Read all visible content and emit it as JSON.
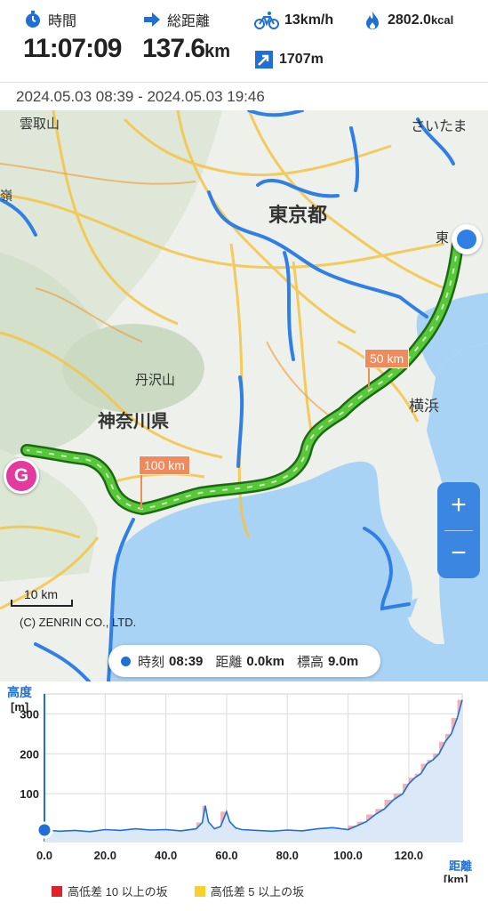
{
  "stats": {
    "time_label": "時間",
    "time_value": "11:07:09",
    "distance_label": "総距離",
    "distance_value": "137.6",
    "distance_unit": "km",
    "speed_value": "13",
    "speed_unit": "km/h",
    "elevation_gain_value": "1707",
    "elevation_gain_unit": "m",
    "calories_value": "2802.0",
    "calories_unit": "kcal"
  },
  "date_range": "2024.05.03 08:39 - 2024.05.03 19:46",
  "map": {
    "places": [
      "雲取山",
      "さいたま",
      "東京都",
      "東",
      "丹沢山",
      "神奈川県",
      "横浜",
      "嶺"
    ],
    "km_markers": [
      "50 km",
      "100 km"
    ],
    "goal_marker": "G",
    "zoom_in": "+",
    "zoom_out": "−",
    "scale_label": "10 km",
    "copyright": "(C) ZENRIN CO., LTD.",
    "info": {
      "time_key": "時刻",
      "time_value": "08:39",
      "distance_key": "距離",
      "distance_value": "0.0km",
      "elevation_key": "標高",
      "elevation_value": "9.0m"
    },
    "colors": {
      "route": "#3fbf2a",
      "road": "#2f7fe6",
      "sea": "#a9d3f5",
      "land": "#eef0ec"
    }
  },
  "chart_data": {
    "type": "area",
    "ylabel_line1": "高度",
    "ylabel_line2": "[m]",
    "xlabel_line1": "距離",
    "xlabel_line2": "[km]",
    "xlim": [
      0,
      137.6
    ],
    "ylim": [
      -20,
      350
    ],
    "x_ticks": [
      "0.0",
      "20.0",
      "40.0",
      "60.0",
      "80.0",
      "100.0",
      "120.0"
    ],
    "x_tick_values": [
      0,
      20,
      40,
      60,
      80,
      100,
      120
    ],
    "y_ticks": [
      "100",
      "200",
      "300"
    ],
    "y_tick_values": [
      100,
      200,
      300
    ],
    "grid": true,
    "series": [
      {
        "color": "#1f6fd6",
        "x": [
          0,
          5,
          10,
          15,
          20,
          25,
          30,
          35,
          40,
          45,
          50,
          52,
          53,
          54,
          56,
          58,
          60,
          61,
          63,
          65,
          70,
          75,
          80,
          85,
          90,
          95,
          100,
          103,
          106,
          109,
          112,
          115,
          118,
          120,
          122,
          124,
          126,
          128,
          130,
          132,
          134,
          136,
          137.6
        ],
        "values": [
          9,
          6,
          8,
          5,
          10,
          8,
          12,
          9,
          10,
          7,
          12,
          28,
          70,
          30,
          12,
          18,
          55,
          30,
          14,
          10,
          8,
          6,
          9,
          7,
          12,
          15,
          10,
          20,
          30,
          48,
          62,
          85,
          100,
          125,
          140,
          150,
          175,
          185,
          200,
          230,
          250,
          290,
          335
        ]
      }
    ],
    "slope_legend": [
      {
        "label": "高低差 10 以上の坂",
        "color": "#e0202a"
      },
      {
        "label": "高低差 5 以上の坂",
        "color": "#f6d02c"
      }
    ]
  }
}
